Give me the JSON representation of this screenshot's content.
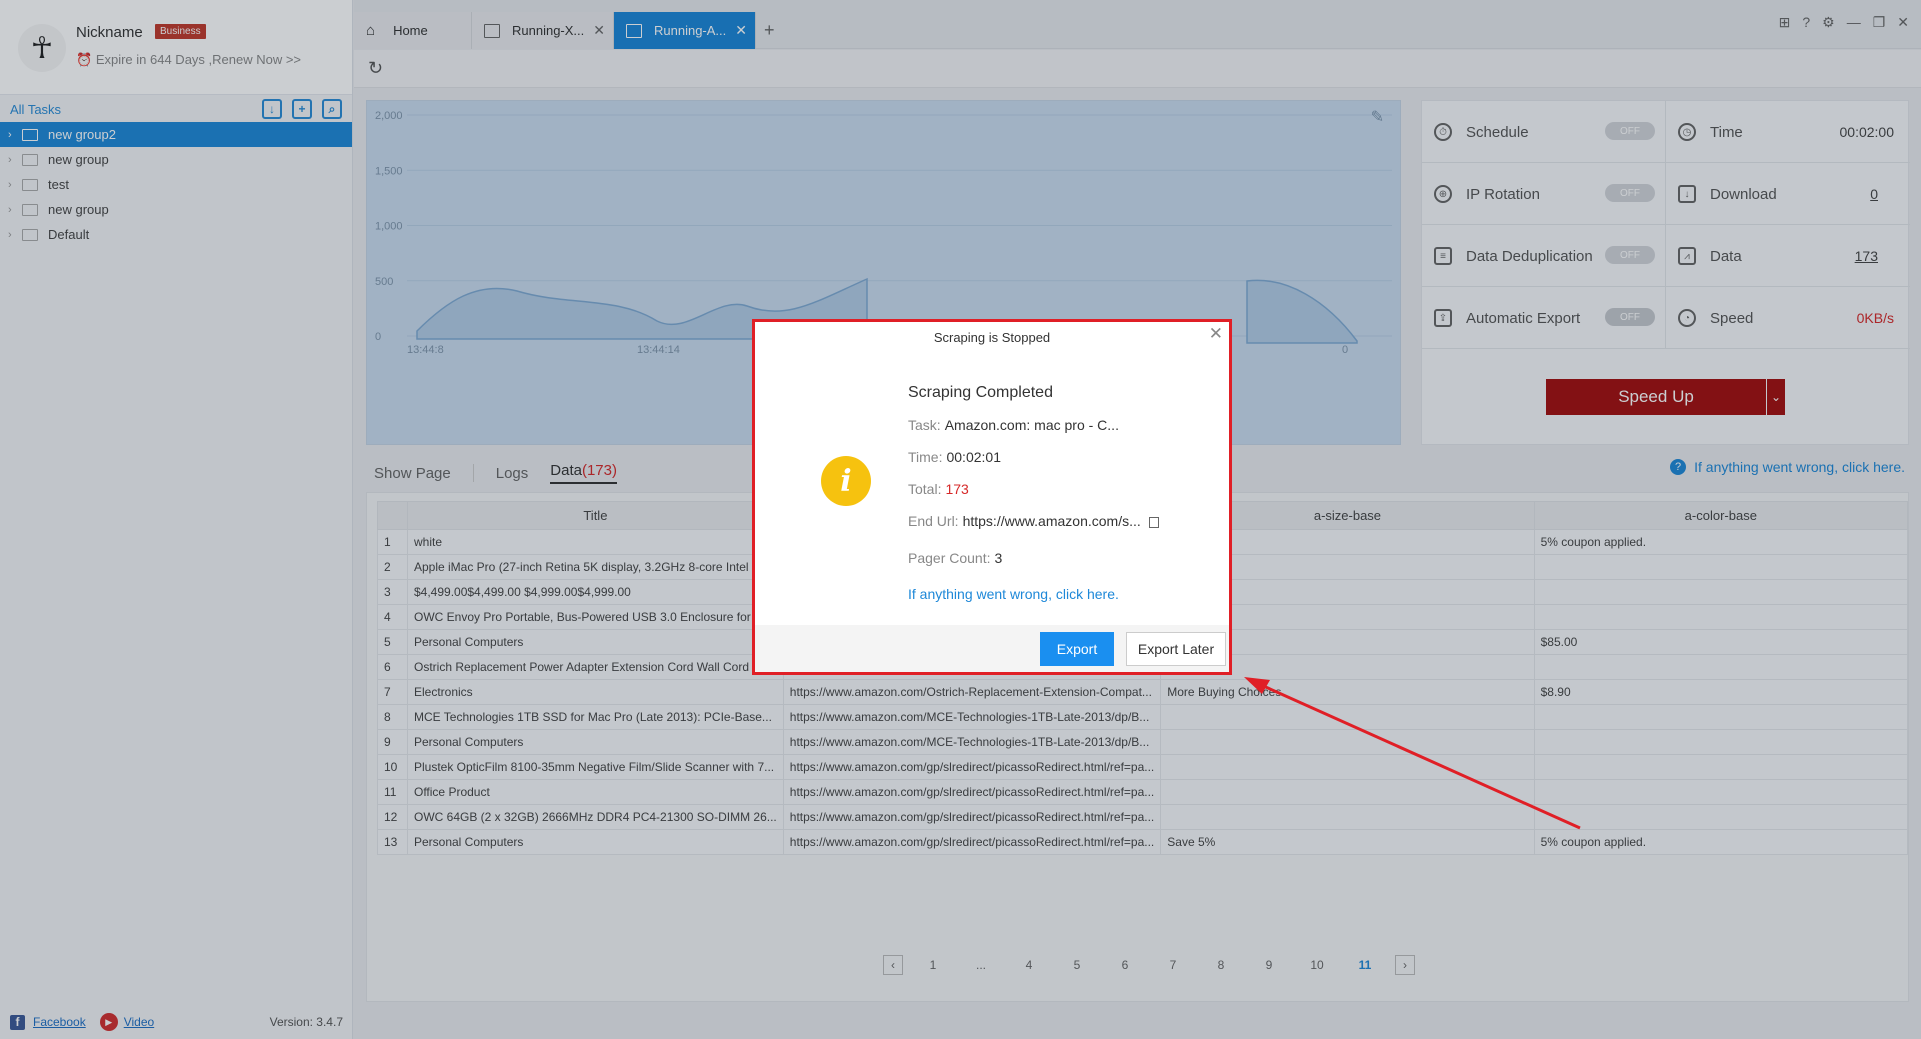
{
  "profile": {
    "nickname": "Nickname",
    "badge": "Business",
    "expire": "Expire in 644 Days ,Renew Now >>"
  },
  "sidebar": {
    "all_tasks": "All Tasks",
    "items": [
      {
        "label": "new group2",
        "active": true
      },
      {
        "label": "new group"
      },
      {
        "label": "test"
      },
      {
        "label": "new group"
      },
      {
        "label": "Default"
      }
    ],
    "footer": {
      "facebook": "Facebook",
      "video": "Video",
      "version": "Version: 3.4.7"
    }
  },
  "tabs": [
    {
      "label": "Home"
    },
    {
      "label": "Running-X..."
    },
    {
      "label": "Running-A...",
      "active": true
    }
  ],
  "chart_data": {
    "type": "area",
    "y_ticks": [
      "2,000",
      "1,500",
      "1,000",
      "500",
      "0"
    ],
    "ylim": [
      0,
      2000
    ],
    "x_ticks": [
      "13:44:8",
      "13:44:14"
    ],
    "grid": true
  },
  "chart_right_label": "0",
  "stats": {
    "schedule": {
      "label": "Schedule",
      "toggle": "OFF"
    },
    "time": {
      "label": "Time",
      "value": "00:02:00"
    },
    "ip_rotation": {
      "label": "IP Rotation",
      "toggle": "OFF"
    },
    "download": {
      "label": "Download",
      "value": "0"
    },
    "dedup": {
      "label": "Data Deduplication",
      "toggle": "OFF"
    },
    "data": {
      "label": "Data",
      "value": "173"
    },
    "auto_export": {
      "label": "Automatic Export",
      "toggle": "OFF"
    },
    "speed": {
      "label": "Speed",
      "value": "0KB/s"
    },
    "speed_up": "Speed Up"
  },
  "data_tabs": {
    "show_page": "Show Page",
    "logs": "Logs",
    "data": "Data",
    "count": "(173)"
  },
  "help_link": "If anything went wrong, click here.",
  "table": {
    "headers": [
      "",
      "Title",
      "",
      "a-size-base",
      "a-color-base"
    ],
    "rows": [
      [
        "1",
        "white",
        "",
        "",
        "5% coupon applied."
      ],
      [
        "2",
        "Apple iMac Pro (27-inch Retina 5K display, 3.2GHz 8-core Intel",
        "",
        "",
        ""
      ],
      [
        "3",
        "$4,499.00$4,499.00 $4,999.00$4,999.00",
        "",
        "",
        ""
      ],
      [
        "4",
        "OWC Envoy Pro Portable, Bus-Powered USB 3.0 Enclosure for",
        "",
        "",
        ""
      ],
      [
        "5",
        "Personal Computers",
        "",
        "Choices",
        "$85.00"
      ],
      [
        "6",
        "Ostrich Replacement Power Adapter Extension Cord Wall Cord",
        "",
        "",
        ""
      ],
      [
        "7",
        "Electronics",
        "https://www.amazon.com/Ostrich-Replacement-Extension-Compat...",
        "More Buying Choices",
        "$8.90"
      ],
      [
        "8",
        "MCE Technologies 1TB SSD for Mac Pro (Late 2013): PCIe-Base...",
        "https://www.amazon.com/MCE-Technologies-1TB-Late-2013/dp/B...",
        "",
        ""
      ],
      [
        "9",
        "Personal Computers",
        "https://www.amazon.com/MCE-Technologies-1TB-Late-2013/dp/B...",
        "",
        ""
      ],
      [
        "10",
        "Plustek OpticFilm 8100-35mm Negative Film/Slide Scanner with 7...",
        "https://www.amazon.com/gp/slredirect/picassoRedirect.html/ref=pa...",
        "",
        ""
      ],
      [
        "11",
        "Office Product",
        "https://www.amazon.com/gp/slredirect/picassoRedirect.html/ref=pa...",
        "",
        ""
      ],
      [
        "12",
        "OWC 64GB (2 x 32GB) 2666MHz DDR4 PC4-21300 SO-DIMM 26...",
        "https://www.amazon.com/gp/slredirect/picassoRedirect.html/ref=pa...",
        "",
        ""
      ],
      [
        "13",
        "Personal Computers",
        "https://www.amazon.com/gp/slredirect/picassoRedirect.html/ref=pa...",
        "Save 5%",
        "5% coupon applied."
      ]
    ]
  },
  "pager": {
    "pages": [
      "1",
      "...",
      "4",
      "5",
      "6",
      "7",
      "8",
      "9",
      "10",
      "11"
    ],
    "current": "11"
  },
  "modal": {
    "title": "Scraping is Stopped",
    "heading": "Scraping Completed",
    "task_label": "Task:",
    "task_value": "Amazon.com: mac pro - C...",
    "time_label": "Time:",
    "time_value": "00:02:01",
    "total_label": "Total:",
    "total_value": "173",
    "end_url_label": "End Url:",
    "end_url_value": "https://www.amazon.com/s...",
    "pager_label": "Pager Count:",
    "pager_value": "3",
    "help_link": "If anything went wrong, click here.",
    "export": "Export",
    "export_later": "Export Later"
  },
  "annotation_color": "#e01f26"
}
